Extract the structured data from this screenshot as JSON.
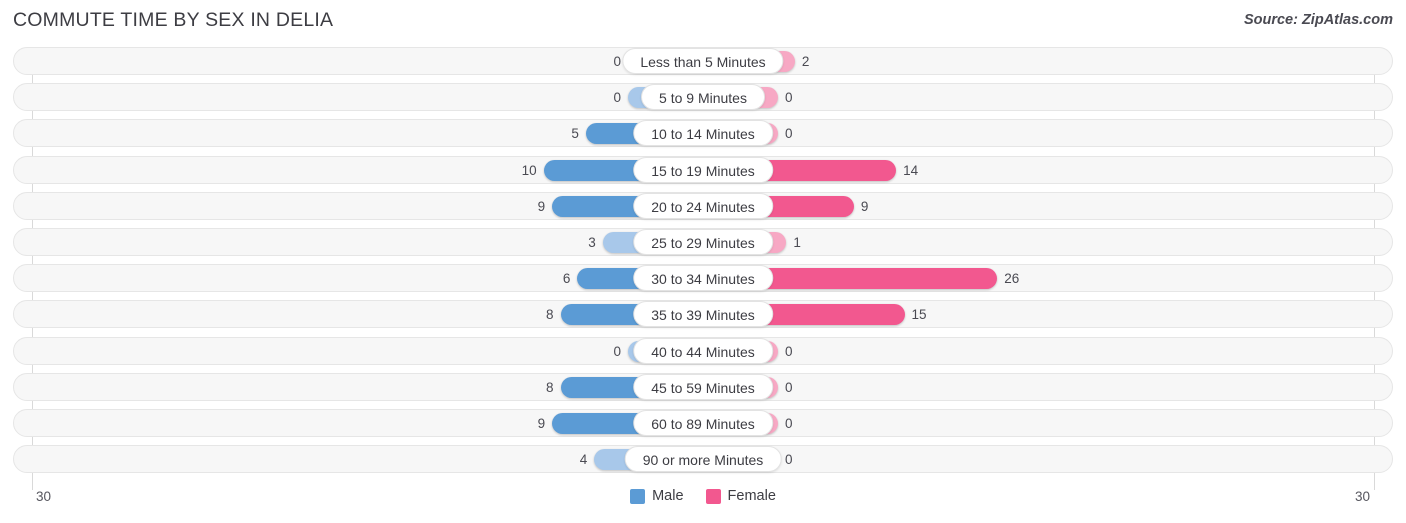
{
  "header": {
    "title": "COMMUTE TIME BY SEX IN DELIA",
    "source": "Source: ZipAtlas.com"
  },
  "legend": {
    "male_label": "Male",
    "female_label": "Female",
    "male_color": "#5b9bd5",
    "female_color": "#f2588f"
  },
  "axis": {
    "left_label": "30",
    "right_label": "30"
  },
  "chart_data": {
    "type": "bar",
    "subtype": "diverging-bidirectional",
    "title": "COMMUTE TIME BY SEX IN DELIA",
    "xlabel": "",
    "ylabel": "",
    "xlim": [
      30,
      30
    ],
    "grid": true,
    "legend_position": "bottom-center",
    "categories": [
      "Less than 5 Minutes",
      "5 to 9 Minutes",
      "10 to 14 Minutes",
      "15 to 19 Minutes",
      "20 to 24 Minutes",
      "25 to 29 Minutes",
      "30 to 34 Minutes",
      "35 to 39 Minutes",
      "40 to 44 Minutes",
      "45 to 59 Minutes",
      "60 to 89 Minutes",
      "90 or more Minutes"
    ],
    "series": [
      {
        "name": "Male",
        "color": "#5b9bd5",
        "direction": "left",
        "values": [
          0,
          0,
          5,
          10,
          9,
          3,
          6,
          8,
          0,
          8,
          9,
          4
        ]
      },
      {
        "name": "Female",
        "color": "#f2588f",
        "direction": "right",
        "values": [
          2,
          0,
          0,
          14,
          9,
          1,
          26,
          15,
          0,
          0,
          0,
          0
        ]
      }
    ]
  }
}
